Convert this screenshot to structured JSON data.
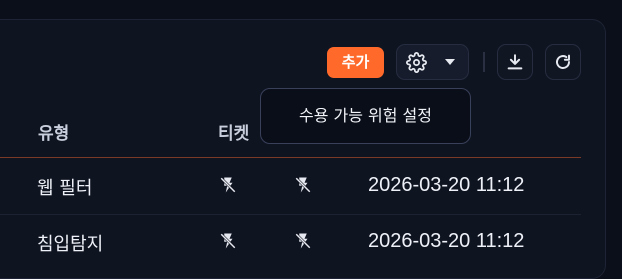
{
  "toolbar": {
    "add_label": "추가",
    "settings_icon": "gear-icon",
    "caret_icon": "chevron-down-icon",
    "download_icon": "download-icon",
    "refresh_icon": "refresh-icon"
  },
  "tooltip": {
    "text": "수용 가능 위험 설정"
  },
  "table": {
    "columns": [
      "유형",
      "티켓"
    ],
    "rows": [
      {
        "type": "웹 필터",
        "date": "2026-03-20 11:12"
      },
      {
        "type": "침입탐지",
        "date": "2026-03-20 11:12"
      }
    ]
  },
  "colors": {
    "accent": "#ff6a2b",
    "background": "#0b0f19",
    "card": "#0f1421"
  }
}
